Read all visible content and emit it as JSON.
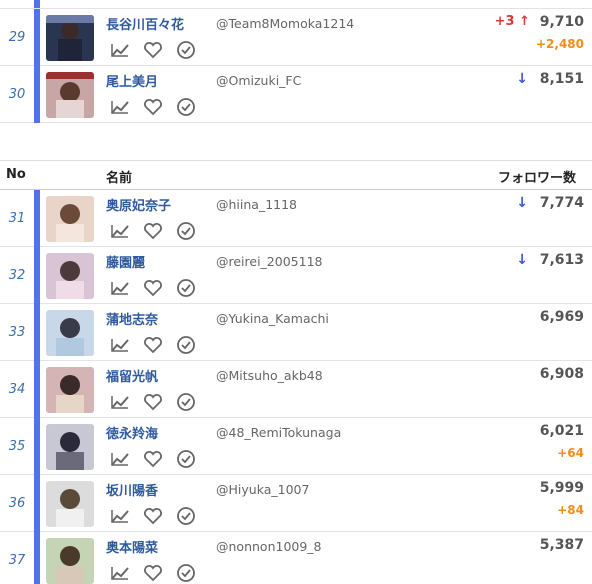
{
  "header": {
    "no": "No",
    "name": "名前",
    "followers": "フォロワー数"
  },
  "icons": {
    "chart": "chart-icon",
    "heart": "heart-icon",
    "check": "check-circle-icon"
  },
  "colors": {
    "accent_bar": "#4f74e6",
    "name_link": "#2f5a9e",
    "up": "#e03838",
    "down": "#3c56d8",
    "delta": "#f28c1b"
  },
  "rows_top": [
    {
      "rank": "29",
      "name": "長谷川百々花",
      "handle": "@Team8Momoka1214",
      "rank_change": "+3 ↑",
      "count": "9,710",
      "delta": "+2,480"
    },
    {
      "rank": "30",
      "name": "尾上美月",
      "handle": "@Omizuki_FC",
      "arrow": "↓",
      "count": "8,151"
    }
  ],
  "rows_bottom": [
    {
      "rank": "31",
      "name": "奥原妃奈子",
      "handle": "@hiina_1118",
      "arrow": "↓",
      "count": "7,774"
    },
    {
      "rank": "32",
      "name": "藤園麗",
      "handle": "@reirei_2005118",
      "arrow": "↓",
      "count": "7,613"
    },
    {
      "rank": "33",
      "name": "蒲地志奈",
      "handle": "@Yukina_Kamachi",
      "count": "6,969"
    },
    {
      "rank": "34",
      "name": "福留光帆",
      "handle": "@Mitsuho_akb48",
      "count": "6,908"
    },
    {
      "rank": "35",
      "name": "徳永羚海",
      "handle": "@48_RemiTokunaga",
      "count": "6,021",
      "delta": "+64"
    },
    {
      "rank": "36",
      "name": "坂川陽香",
      "handle": "@Hiyuka_1007",
      "count": "5,999",
      "delta": "+84"
    },
    {
      "rank": "37",
      "name": "奥本陽菜",
      "handle": "@nonnon1009_8",
      "count": "5,387"
    }
  ]
}
